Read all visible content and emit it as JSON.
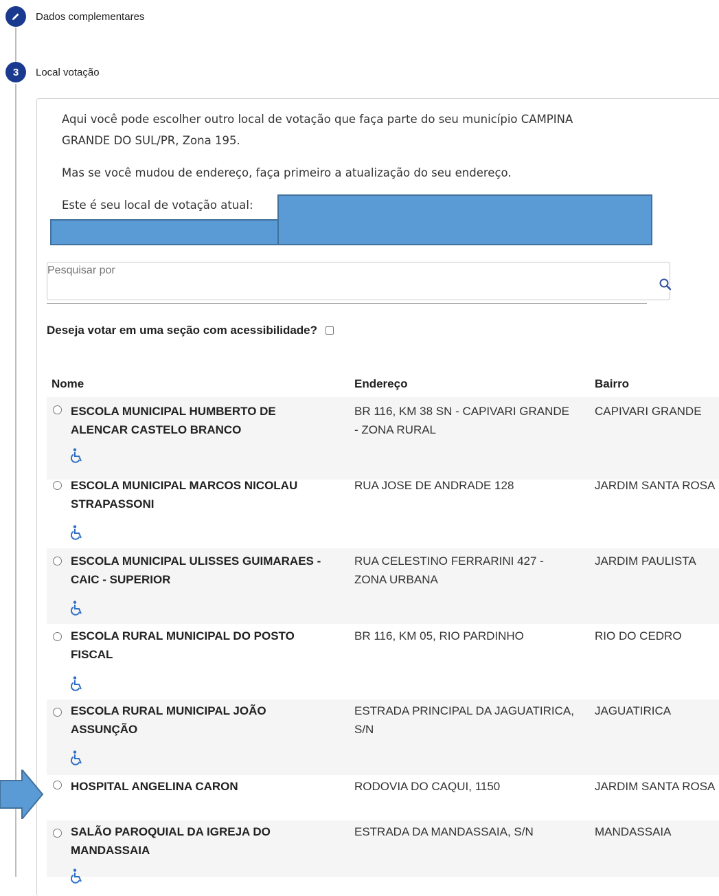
{
  "steps": {
    "dados": {
      "label": "Dados complementares"
    },
    "local": {
      "number": "3",
      "label": "Local votação"
    }
  },
  "intro": {
    "line1": "Aqui você pode escolher outro local de votação que faça parte do seu município CAMPINA",
    "line2": "GRANDE DO SUL/PR, Zona 195.",
    "line3": "Mas se você mudou de endereço, faça primeiro a atualização do seu endereço.",
    "line4": "Este é seu local de votação atual:"
  },
  "search": {
    "placeholder": "Pesquisar por"
  },
  "accessibility": {
    "label": "Deseja votar em uma seção com acessibilidade?"
  },
  "table": {
    "headers": {
      "nome": "Nome",
      "endereco": "Endereço",
      "bairro": "Bairro"
    },
    "rows": [
      {
        "nome": "ESCOLA MUNICIPAL HUMBERTO DE ALENCAR CASTELO BRANCO",
        "endereco": "BR 116, KM 38 SN - CAPIVARI GRANDE - ZONA RURAL",
        "bairro": "CAPIVARI GRANDE"
      },
      {
        "nome": "ESCOLA MUNICIPAL MARCOS NICOLAU STRAPASSONI",
        "endereco": "RUA JOSE DE ANDRADE 128",
        "bairro": "JARDIM SANTA ROSA"
      },
      {
        "nome": "ESCOLA MUNICIPAL ULISSES GUIMARAES - CAIC - SUPERIOR",
        "endereco": "RUA CELESTINO FERRARINI 427 - ZONA URBANA",
        "bairro": "JARDIM PAULISTA"
      },
      {
        "nome": "ESCOLA RURAL MUNICIPAL DO POSTO FISCAL",
        "endereco": "BR 116, KM 05, RIO PARDINHO",
        "bairro": "RIO DO CEDRO"
      },
      {
        "nome": "ESCOLA RURAL MUNICIPAL JOÃO ASSUNÇÃO",
        "endereco": "ESTRADA PRINCIPAL DA JAGUATIRICA, S/N",
        "bairro": "JAGUATIRICA"
      },
      {
        "nome": "HOSPITAL ANGELINA CARON",
        "endereco": "RODOVIA DO CAQUI, 1150",
        "bairro": "JARDIM SANTA ROSA"
      },
      {
        "nome": "SALÃO PAROQUIAL DA IGREJA DO MANDASSAIA",
        "endereco": "ESTRADA DA MANDASSAIA, S/N",
        "bairro": "MANDASSAIA"
      }
    ]
  },
  "colors": {
    "accent": "#1a3a8f",
    "icon_blue": "#2f6fc4",
    "arrow": "#5b9bd5"
  }
}
